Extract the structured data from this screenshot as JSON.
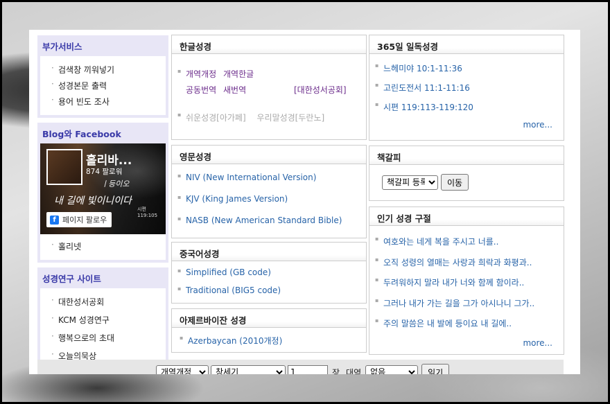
{
  "left": {
    "services": {
      "title": "부가서비스",
      "items": [
        "검색창 끼워넣기",
        "성경본문 출력",
        "용어 빈도 조사"
      ]
    },
    "blog": {
      "title": "Blog와 Facebook",
      "fb_name": "홀리바...",
      "fb_followers": "874 팔로워",
      "fb_script1": "ㅣ등이오",
      "fb_script2": "내 길에 빛이니이다",
      "fb_script3": "시편119:105",
      "fb_follow_button": "페이지 팔로우",
      "items": [
        "홀리넷"
      ]
    },
    "research": {
      "title": "성경연구 사이트",
      "items": [
        "대한성서공회",
        "KCM 성경연구",
        "행복으로의 초대",
        "오늘의묵상"
      ]
    }
  },
  "korean": {
    "title": "한글성경",
    "row1": [
      "개역개정",
      "개역한글"
    ],
    "row2": [
      "공동번역",
      "새번역"
    ],
    "row2_right": "[대한성서공회]",
    "row3": [
      "쉬운성경[아가페]",
      "우리말성경[두란노]"
    ]
  },
  "english": {
    "title": "영문성경",
    "items": [
      "NIV (New International Version)",
      "KJV (King James Version)",
      "NASB (New American Standard Bible)"
    ]
  },
  "chinese": {
    "title": "중국어성경",
    "items": [
      "Simplified (GB code)",
      "Traditional (BIG5 code)"
    ]
  },
  "azerbaijani": {
    "title": "아제르바이잔 성경",
    "items": [
      "Azerbaycan (2010개정)"
    ]
  },
  "daily": {
    "title": "365일 일독성경",
    "items": [
      "느헤미야 10:1-11:36",
      "고린도전서 11:1-11:16",
      "시편 119:113-119:120"
    ],
    "more": "more..."
  },
  "bookmark": {
    "title": "책갈피",
    "select_value": "책갈피 등록",
    "button": "이동"
  },
  "popular": {
    "title": "인기 성경 구절",
    "items": [
      "여호와는 네게 복을 주시고 너를..",
      "오직 성령의 열매는 사랑과 희락과 화평과..",
      "두려워하지 말라 내가 너와 함께 함이라..",
      "그러나 내가 가는 길을 그가 아시나니 그가..",
      "주의 말씀은 내 발에 등이요 내 길에.."
    ],
    "more": "more..."
  },
  "bottom": {
    "version_select": "개역개정",
    "book_select": "창세기",
    "chapter_value": "1",
    "chapter_label": "장",
    "compare_label": "대역",
    "compare_select": "없음",
    "read_button": "읽기"
  },
  "colors": {
    "accent_purple": "#6a2a8a",
    "link_blue": "#2763a8",
    "sidebar_bg": "#e8e6f6",
    "sidebar_title": "#3a3aa8"
  }
}
